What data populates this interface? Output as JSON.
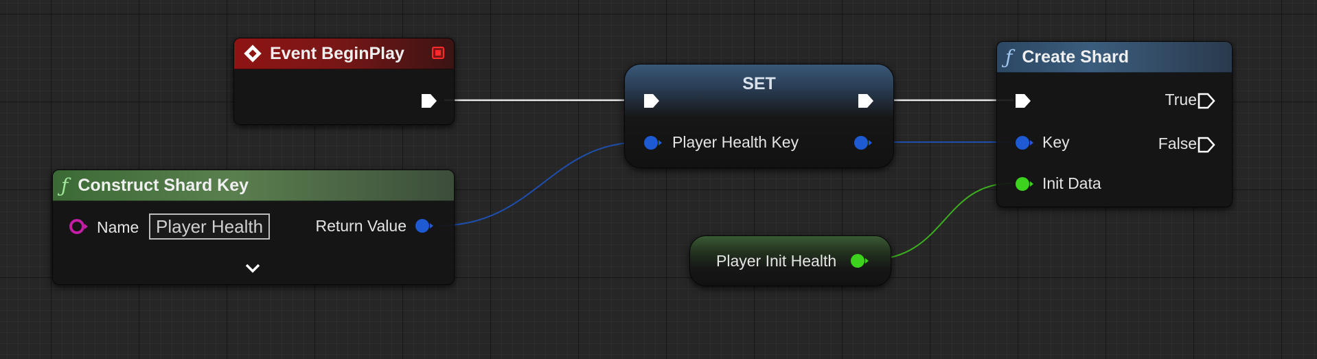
{
  "nodes": {
    "event_begin_play": {
      "title": "Event BeginPlay",
      "header_color": "#8f1414"
    },
    "construct_shard_key": {
      "title": "Construct Shard Key",
      "func_glyph": "ƒ",
      "name_label": "Name",
      "name_value": "Player Health",
      "return_label": "Return Value",
      "header_color": "#5a7f4f"
    },
    "set_node": {
      "title": "SET",
      "var_label": "Player Health Key",
      "header_color": "#3b5d7d"
    },
    "create_shard": {
      "title": "Create Shard",
      "func_glyph": "ƒ",
      "true_label": "True",
      "false_label": "False",
      "key_label": "Key",
      "init_data_label": "Init Data",
      "header_color": "#3b5d7d"
    },
    "player_init_health": {
      "label": "Player Init Health"
    }
  },
  "pin_colors": {
    "exec": "#ffffff",
    "struct_blue": "#1e5ad2",
    "name_magenta": "#c41ea6",
    "data_green": "#3cd21e"
  },
  "icons": {
    "event": "event-diamond-icon",
    "function": "function-f-icon",
    "delegate": "delegate-square-icon",
    "expand": "chevron-down-icon"
  }
}
